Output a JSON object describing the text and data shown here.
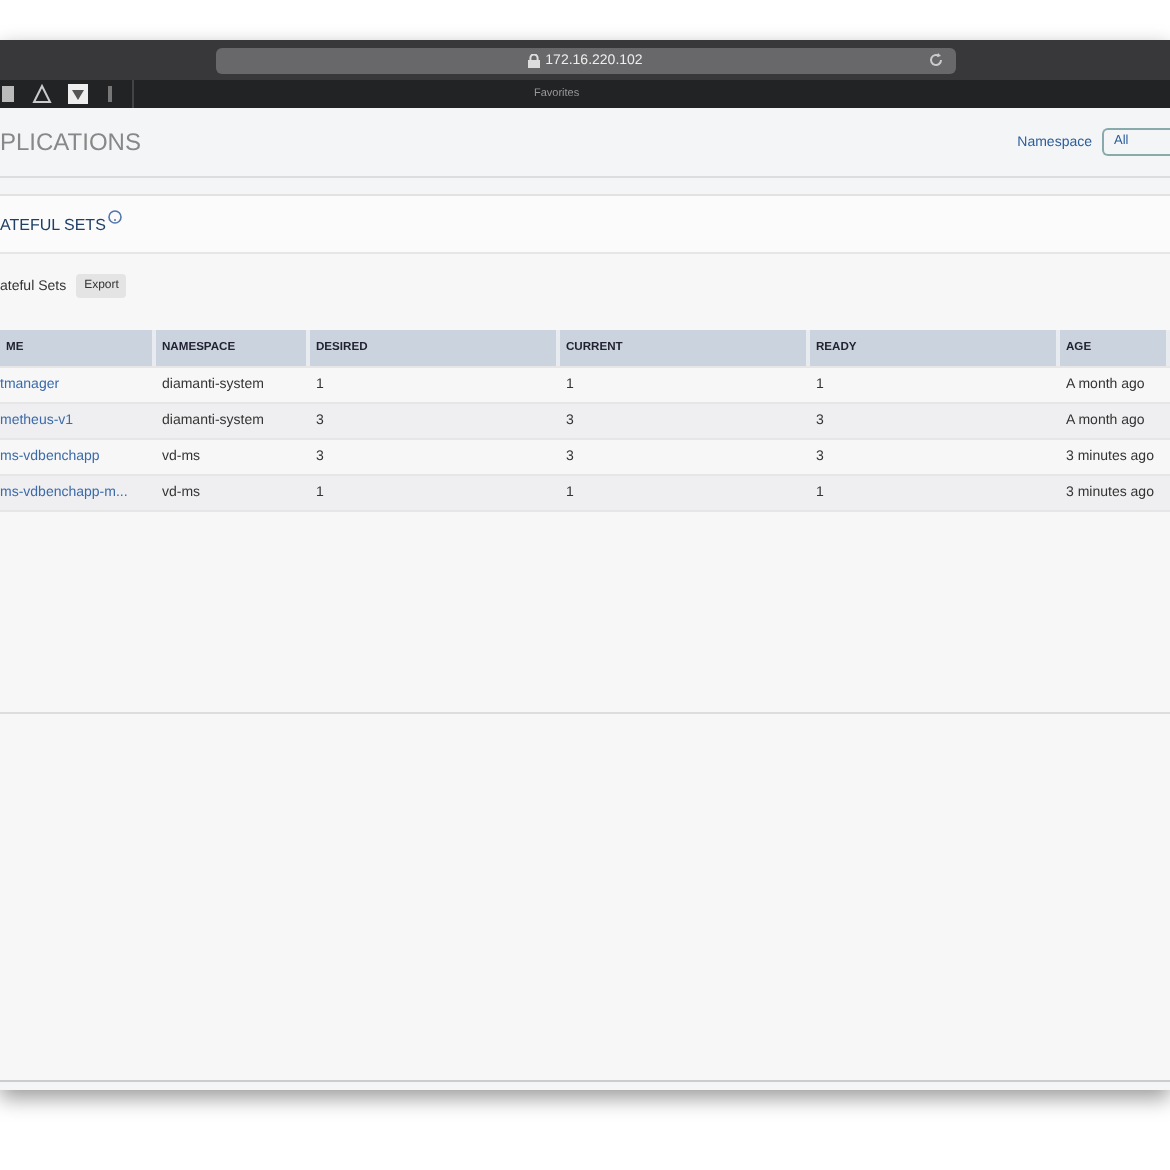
{
  "browser": {
    "url": "172.16.220.102",
    "favorites_label": "Favorites"
  },
  "header": {
    "title": "PLICATIONS",
    "namespace_label": "Namespace",
    "namespace_value": "All"
  },
  "section": {
    "title": "ATEFUL SETS",
    "toolbar_label": "ateful Sets",
    "export_button": "Export"
  },
  "table": {
    "columns": [
      "ME",
      "NAMESPACE",
      "DESIRED",
      "CURRENT",
      "READY",
      "AGE"
    ],
    "rows": [
      {
        "cells": [
          "tmanager",
          "diamanti-system",
          "1",
          "1",
          "1",
          "A month ago"
        ]
      },
      {
        "cells": [
          "metheus-v1",
          "diamanti-system",
          "3",
          "3",
          "3",
          "A month ago"
        ]
      },
      {
        "cells": [
          "ms-vdbenchapp",
          "vd-ms",
          "3",
          "3",
          "3",
          "3 minutes ago"
        ]
      },
      {
        "cells": [
          "ms-vdbenchapp-m...",
          "vd-ms",
          "1",
          "1",
          "1",
          "3 minutes ago"
        ]
      }
    ]
  }
}
